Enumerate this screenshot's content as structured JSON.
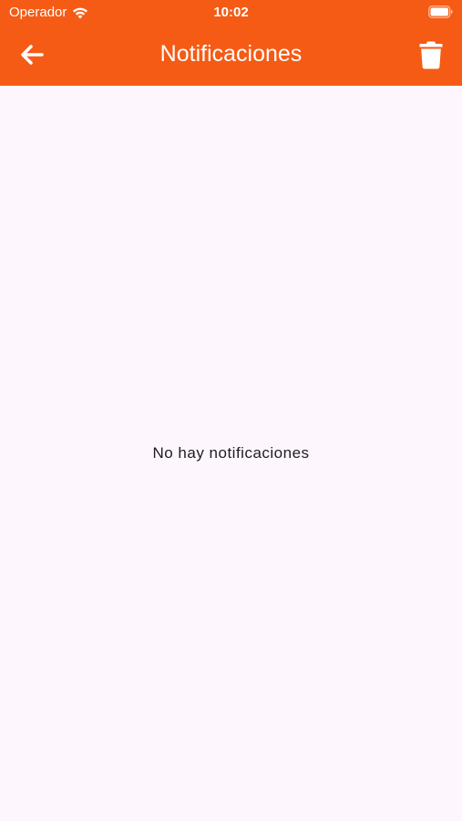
{
  "status_bar": {
    "carrier": "Operador",
    "time": "10:02",
    "wifi_icon": "wifi-icon",
    "battery_icon": "battery-icon"
  },
  "app_bar": {
    "title": "Notificaciones",
    "back_icon": "arrow-left-icon",
    "delete_icon": "trash-icon",
    "background_color": "#f55b14"
  },
  "main": {
    "empty_message": "No hay notificaciones",
    "background_color": "#fdf7fd"
  }
}
